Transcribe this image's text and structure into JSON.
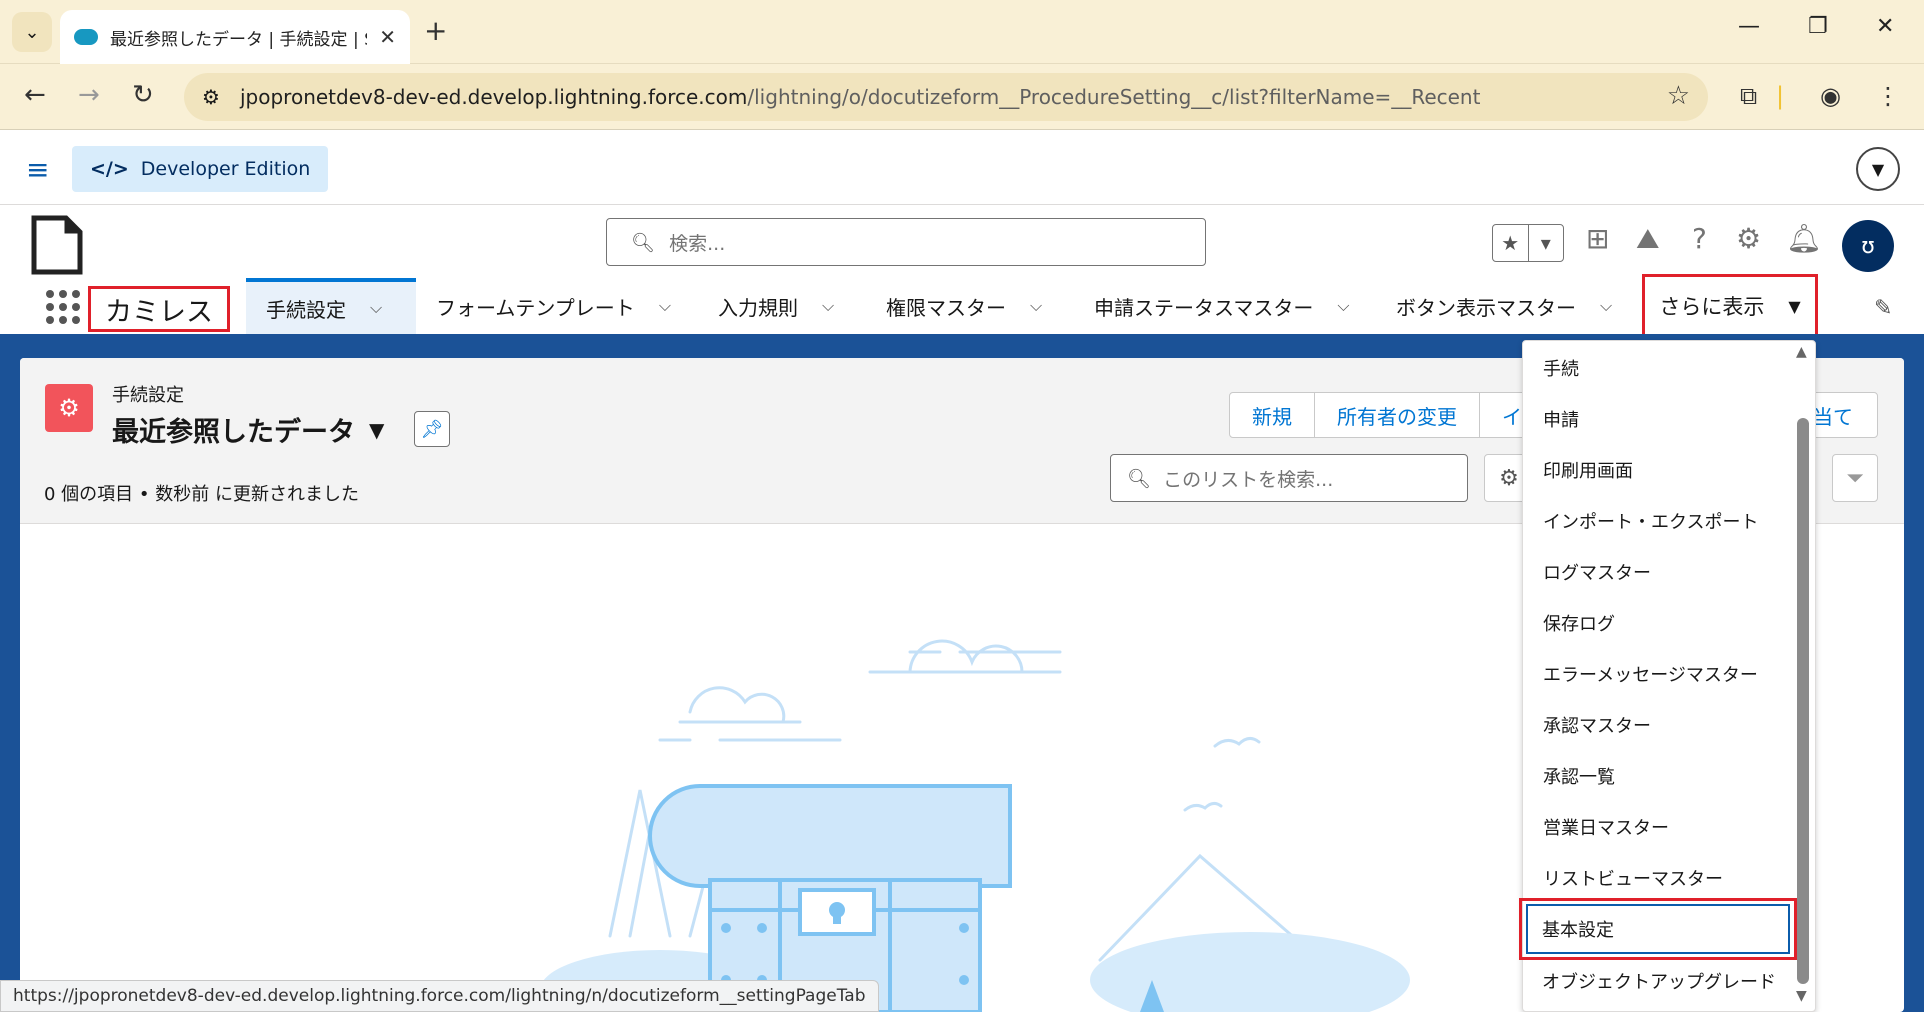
{
  "browser": {
    "tab_title": "最近参照したデータ | 手続設定 | S...",
    "url_domain": "jpopronetdev8-dev-ed.develop.lightning.force.com",
    "url_path": "/lightning/o/docutizeform__ProcedureSetting__c/list?filterName=__Recent",
    "status_url": "https://jpopronetdev8-dev-ed.develop.lightning.force.com/lightning/n/docutizeform__settingPageTab"
  },
  "devbar": {
    "label": "Developer Edition"
  },
  "header": {
    "search_placeholder": "検索..."
  },
  "appnav": {
    "app_name": "カミレス",
    "items": [
      {
        "label": "手続設定"
      },
      {
        "label": "フォームテンプレート"
      },
      {
        "label": "入力規則"
      },
      {
        "label": "権限マスター"
      },
      {
        "label": "申請ステータスマスター"
      },
      {
        "label": "ボタン表示マスター"
      }
    ],
    "more_label": "さらに表示"
  },
  "list": {
    "object_label": "手続設定",
    "view_name": "最近参照したデータ",
    "meta": "0 個の項目 • 数秒前 に更新されました",
    "buttons": [
      "新規",
      "所有者の変更",
      "イ"
    ],
    "assign_partial": "当て",
    "search_placeholder": "このリストを検索..."
  },
  "dropdown": {
    "items": [
      "手続",
      "申請",
      "印刷用画面",
      "インポート・エクスポート",
      "ログマスター",
      "保存ログ",
      "エラーメッセージマスター",
      "承認マスター",
      "承認一覧",
      "営業日マスター",
      "リストビューマスター",
      "基本設定",
      "オブジェクトアップグレード"
    ],
    "selected": "基本設定"
  }
}
